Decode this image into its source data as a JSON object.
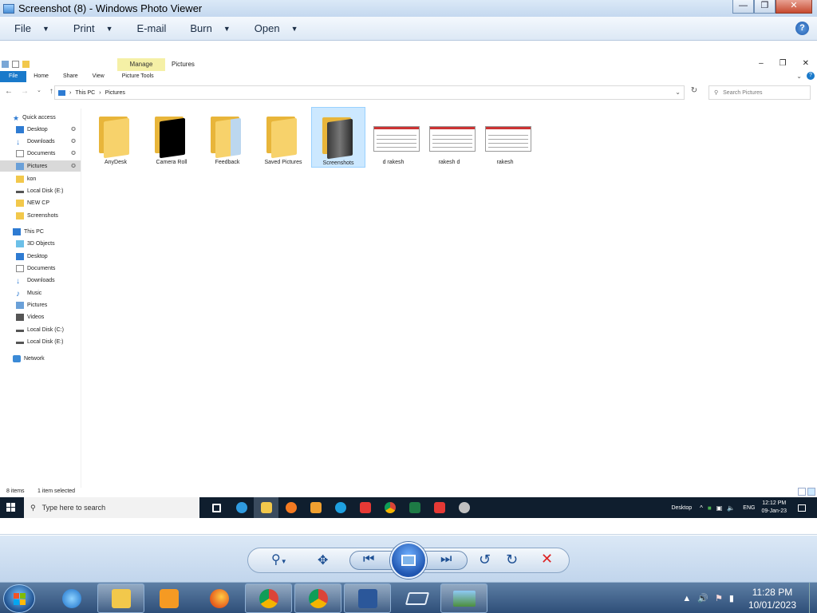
{
  "viewer": {
    "title": "Screenshot (8) - Windows Photo Viewer",
    "menu": [
      {
        "label": "File",
        "has_caret": true
      },
      {
        "label": "Print",
        "has_caret": true
      },
      {
        "label": "E-mail",
        "has_caret": false
      },
      {
        "label": "Burn",
        "has_caret": true
      },
      {
        "label": "Open",
        "has_caret": true
      }
    ],
    "help_glyph": "?"
  },
  "explorer": {
    "manage_tab": "Manage",
    "window_title": "Pictures",
    "tabs": {
      "file": "File",
      "home": "Home",
      "share": "Share",
      "view": "View",
      "picture_tools": "Picture Tools"
    },
    "address": {
      "root": "This PC",
      "folder": "Pictures"
    },
    "search_placeholder": "Search Pictures",
    "nav": {
      "quick_access": "Quick access",
      "qa_desktop": "Desktop",
      "qa_downloads": "Downloads",
      "qa_documents": "Documents",
      "qa_pictures": "Pictures",
      "qa_kon": "kon",
      "qa_local_e": "Local Disk (E:)",
      "qa_new_cp": "NEW CP",
      "qa_screenshots": "Screenshots",
      "this_pc": "This PC",
      "pc_3d": "3D Objects",
      "pc_desktop": "Desktop",
      "pc_documents": "Documents",
      "pc_downloads": "Downloads",
      "pc_music": "Music",
      "pc_pictures": "Pictures",
      "pc_videos": "Videos",
      "pc_local_c": "Local Disk (C:)",
      "pc_local_e": "Local Disk (E:)",
      "network": "Network"
    },
    "items": [
      {
        "name": "AnyDesk",
        "kind": "folder"
      },
      {
        "name": "Camera Roll",
        "kind": "folder-dark"
      },
      {
        "name": "Feedback",
        "kind": "folder-papers"
      },
      {
        "name": "Saved Pictures",
        "kind": "folder"
      },
      {
        "name": "Screenshots",
        "kind": "folder-dark",
        "selected": true
      },
      {
        "name": "d rakesh",
        "kind": "image"
      },
      {
        "name": "rakesh d",
        "kind": "image"
      },
      {
        "name": "rakesh",
        "kind": "image"
      }
    ],
    "status": {
      "count": "8 items",
      "selected": "1 item selected"
    }
  },
  "win10_taskbar": {
    "search_placeholder": "Type here to search",
    "desktop_label": "Desktop",
    "language": "ENG",
    "time": "12:12 PM",
    "date": "09-Jan-23"
  },
  "win7_taskbar": {
    "time": "11:28 PM",
    "date": "10/01/2023"
  }
}
